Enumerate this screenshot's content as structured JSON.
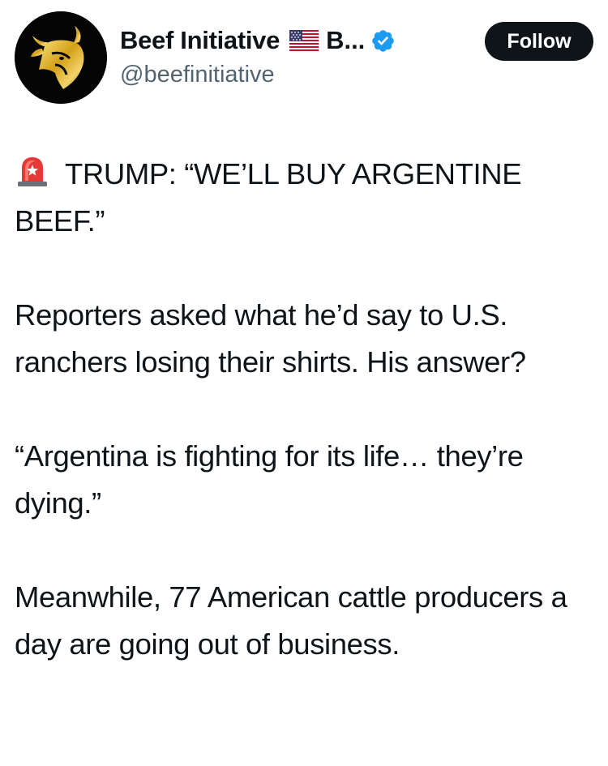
{
  "author": {
    "display_name": "Beef Initiative",
    "name_truncation": "B...",
    "handle": "@beefinitiative",
    "flag_icon": "us-flag-icon",
    "verified_icon": "verified-badge-icon",
    "avatar_icon": "golden-bull-logo-icon"
  },
  "follow": {
    "label": "Follow"
  },
  "tweet": {
    "siren_icon": "police-siren-icon",
    "paragraphs": [
      "TRUMP: “WE’LL BUY ARGENTINE BEEF.”",
      "Reporters asked what he’d say to U.S. ranchers losing their shirts. His answer?",
      "“Argentina is fighting for its life… they’re dying.”",
      "Meanwhile, 77 American cattle producers a day are going out of business."
    ]
  },
  "colors": {
    "text": "#0f1419",
    "secondary_text": "#536471",
    "verified_blue": "#1d9bf0",
    "button_bg": "#0f1419",
    "button_text": "#ffffff",
    "logo_gold": "#d4a017"
  }
}
